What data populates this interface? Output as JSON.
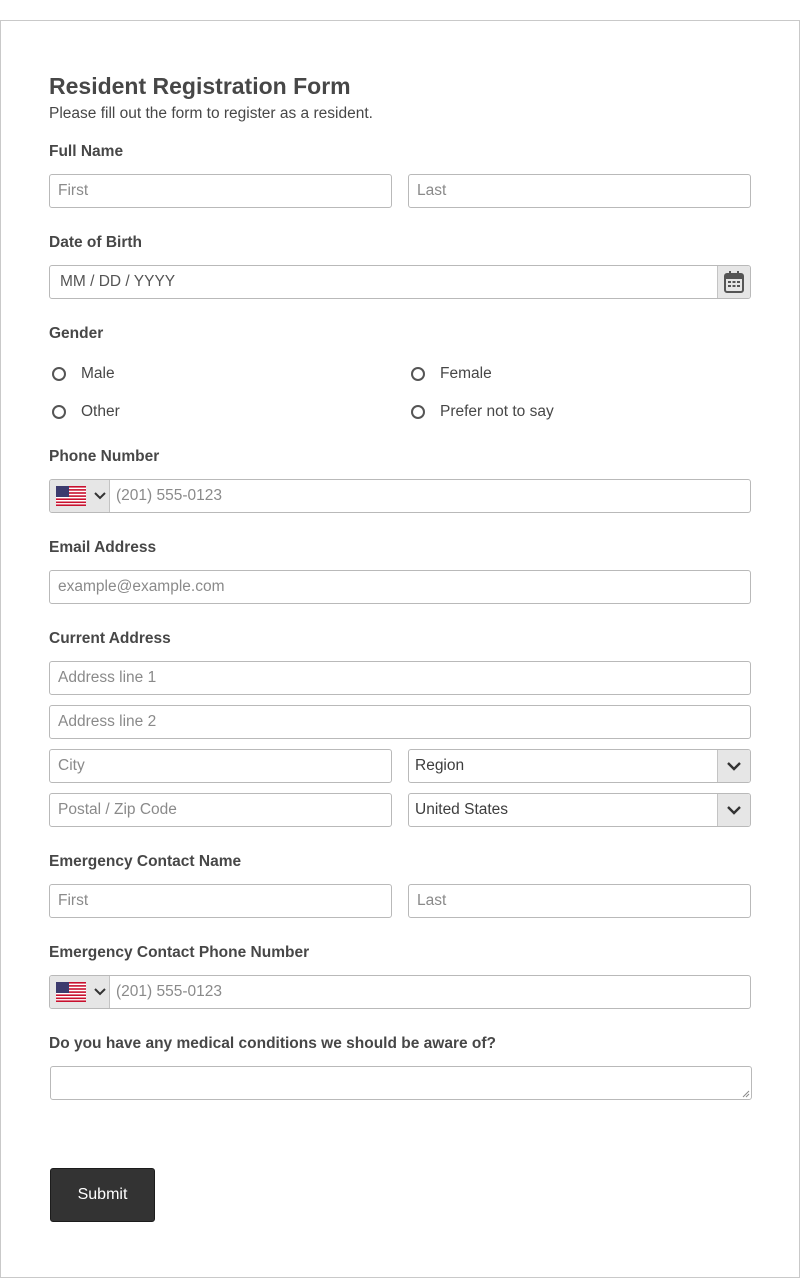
{
  "form": {
    "title": "Resident Registration Form",
    "subtitle": "Please fill out the form to register as a resident.",
    "full_name": {
      "label": "Full Name",
      "first_placeholder": "First",
      "last_placeholder": "Last"
    },
    "dob": {
      "label": "Date of Birth",
      "placeholder": "MM / DD / YYYY",
      "icon": "calendar-icon"
    },
    "gender": {
      "label": "Gender",
      "options": [
        "Male",
        "Female",
        "Other",
        "Prefer not to say"
      ]
    },
    "phone": {
      "label": "Phone Number",
      "country_icon": "us-flag-icon",
      "placeholder": "(201) 555-0123"
    },
    "email": {
      "label": "Email Address",
      "placeholder": "example@example.com"
    },
    "address": {
      "label": "Current Address",
      "line1_placeholder": "Address line 1",
      "line2_placeholder": "Address line 2",
      "city_placeholder": "City",
      "region_value": "Region",
      "postal_placeholder": "Postal / Zip Code",
      "country_value": "United States"
    },
    "emergency_name": {
      "label": "Emergency Contact Name",
      "first_placeholder": "First",
      "last_placeholder": "Last"
    },
    "emergency_phone": {
      "label": "Emergency Contact Phone Number",
      "country_icon": "us-flag-icon",
      "placeholder": "(201) 555-0123"
    },
    "medical": {
      "label": "Do you have any medical conditions we should be aware of?",
      "value": ""
    },
    "submit_label": "Submit"
  },
  "colors": {
    "button_bg": "#333333",
    "border": "#b9b9b9",
    "addon_bg": "#e6e6e6",
    "text": "#474747"
  }
}
